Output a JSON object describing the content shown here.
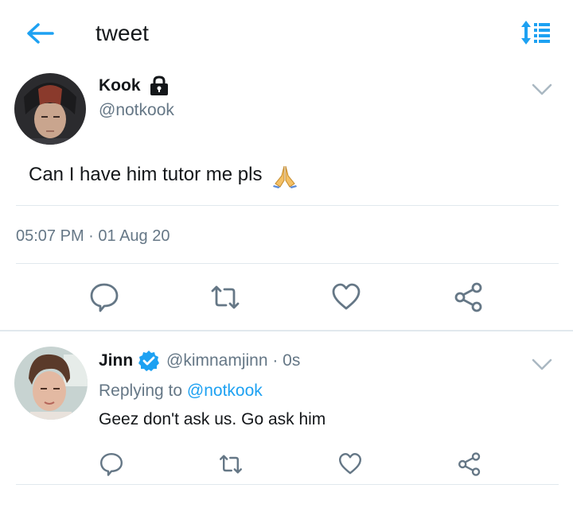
{
  "header": {
    "title": "tweet",
    "back_icon": "arrow-left-icon",
    "sort_icon": "sort-list-icon",
    "accent_color": "#1da1f2"
  },
  "tweet": {
    "author_name": "Kook",
    "author_handle": "@notkook",
    "protected_icon": "lock-icon",
    "text": "Can I have him tutor me pls",
    "emoji_icon": "folded-hands-icon",
    "timestamp": "05:07 PM · 01 Aug 20",
    "actions": [
      "reply-icon",
      "retweet-icon",
      "like-icon",
      "share-icon"
    ]
  },
  "reply": {
    "author_name": "Jinn",
    "verified_icon": "verified-badge-icon",
    "author_handle": "@kimnamjinn · 0s",
    "replying_prefix": "Replying to",
    "replying_to": "@notkook",
    "text": "Geez don't ask us. Go ask him",
    "actions": [
      "reply-icon",
      "retweet-icon",
      "like-icon",
      "share-icon"
    ]
  },
  "colors": {
    "text_primary": "#14171a",
    "text_secondary": "#657786",
    "accent": "#1da1f2",
    "divider": "#e1e8ed"
  }
}
